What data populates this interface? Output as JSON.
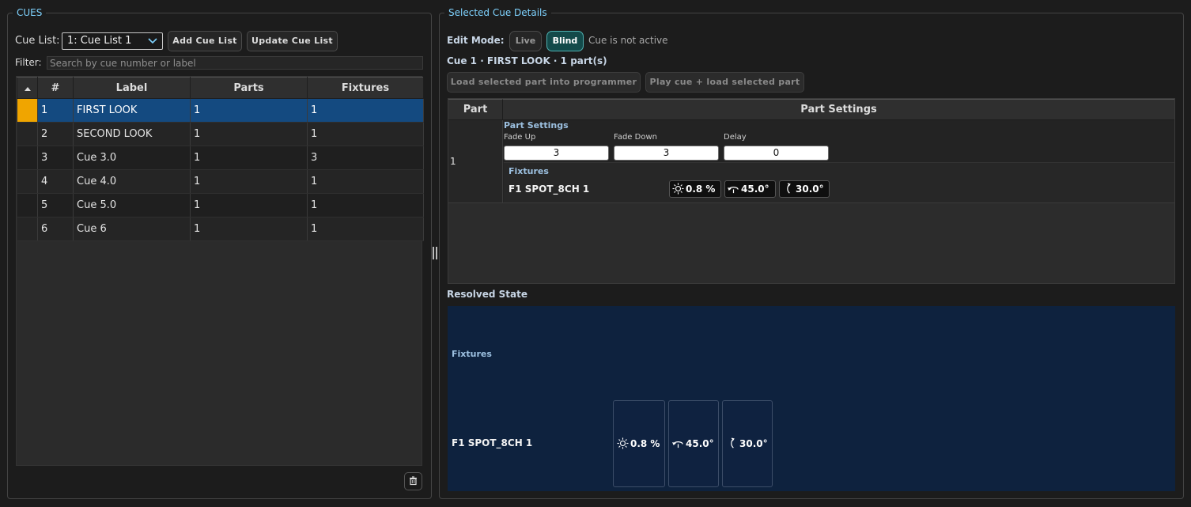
{
  "cues_panel": {
    "legend": "CUES",
    "cue_list_label": "Cue List:",
    "cue_list_selected": "1: Cue List 1",
    "add_cue_list_label": "Add Cue List",
    "update_cue_list_label": "Update Cue List",
    "filter_label": "Filter:",
    "filter_placeholder": "Search by cue number or label",
    "filter_value": "",
    "table": {
      "columns": [
        "#",
        "Label",
        "Parts",
        "Fixtures"
      ],
      "rows": [
        {
          "num": "1",
          "label": "FIRST LOOK",
          "parts": "1",
          "fixtures": "1",
          "selected": true
        },
        {
          "num": "2",
          "label": "SECOND LOOK",
          "parts": "1",
          "fixtures": "1",
          "selected": false
        },
        {
          "num": "3",
          "label": "Cue 3.0",
          "parts": "1",
          "fixtures": "3",
          "selected": false
        },
        {
          "num": "4",
          "label": "Cue 4.0",
          "parts": "1",
          "fixtures": "1",
          "selected": false
        },
        {
          "num": "5",
          "label": "Cue 5.0",
          "parts": "1",
          "fixtures": "1",
          "selected": false
        },
        {
          "num": "6",
          "label": "Cue 6",
          "parts": "1",
          "fixtures": "1",
          "selected": false
        }
      ]
    }
  },
  "details_panel": {
    "legend": "Selected Cue Details",
    "edit_mode_label": "Edit Mode:",
    "live_label": "Live",
    "blind_label": "Blind",
    "active_mode": "Blind",
    "status_text": "Cue is not active",
    "cue_title": "Cue 1 · FIRST LOOK · 1 part(s)",
    "load_part_label": "Load selected part into programmer",
    "play_cue_label": "Play cue + load selected part",
    "parts_table": {
      "col_part": "Part",
      "col_settings": "Part Settings",
      "part_number": "1",
      "settings_header": "Part Settings",
      "fade_up_label": "Fade Up",
      "fade_up_value": "3",
      "fade_down_label": "Fade Down",
      "fade_down_value": "3",
      "delay_label": "Delay",
      "delay_value": "0",
      "fixtures_header": "Fixtures",
      "fixture_name": "F1 SPOT_8CH 1",
      "intensity": "0.8 %",
      "pan": "45.0°",
      "tilt": "30.0°"
    },
    "resolved": {
      "title": "Resolved State",
      "fixtures_header": "Fixtures",
      "fixture_name": "F1 SPOT_8CH 1",
      "intensity": "0.8 %",
      "pan": "45.0°",
      "tilt": "30.0°"
    }
  },
  "colors": {
    "accent": "#7fd3ff",
    "selected_row": "#144a80",
    "marker": "#f0a500",
    "resolved_bg": "#0e223e",
    "blind_active": "#134a4a"
  }
}
